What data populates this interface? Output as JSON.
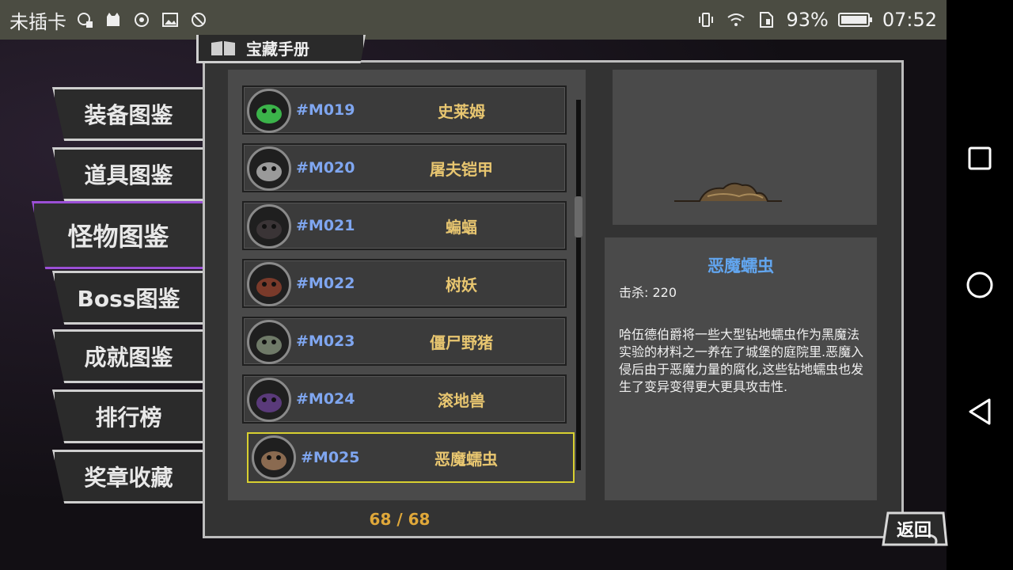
{
  "status_bar": {
    "carrier": "未插卡",
    "battery": "93%",
    "time": "07:52",
    "icons": [
      "sim-bubble-icon",
      "cat-app-icon",
      "camera-ring-icon",
      "image-icon",
      "no-circle-icon",
      "vibrate-icon",
      "wifi-icon",
      "sim-card-icon",
      "battery-icon"
    ]
  },
  "navbar": {
    "icons": [
      "recent-apps-icon",
      "home-icon",
      "back-triangle-icon"
    ]
  },
  "title": "宝藏手册",
  "tabs": [
    {
      "label": "装备图鉴",
      "active": false
    },
    {
      "label": "道具图鉴",
      "active": false
    },
    {
      "label": "怪物图鉴",
      "active": true
    },
    {
      "label": "Boss图鉴",
      "active": false
    },
    {
      "label": "成就图鉴",
      "active": false
    },
    {
      "label": "排行榜",
      "active": false
    },
    {
      "label": "奖章收藏",
      "active": false
    }
  ],
  "monsters": [
    {
      "id": "#M019",
      "name": "史莱姆",
      "icon": "slime-icon",
      "color": "#3bb34a"
    },
    {
      "id": "#M020",
      "name": "屠夫铠甲",
      "icon": "armor-icon",
      "color": "#9a9a9a"
    },
    {
      "id": "#M021",
      "name": "蝙蝠",
      "icon": "bat-icon",
      "color": "#3a3436"
    },
    {
      "id": "#M022",
      "name": "树妖",
      "icon": "treant-icon",
      "color": "#7a3a2a"
    },
    {
      "id": "#M023",
      "name": "僵尸野猪",
      "icon": "zombie-boar-icon",
      "color": "#6f7a68"
    },
    {
      "id": "#M024",
      "name": "滚地兽",
      "icon": "roller-beast-icon",
      "color": "#5a3a7a"
    },
    {
      "id": "#M025",
      "name": "恶魔蠕虫",
      "icon": "worm-icon",
      "color": "#8a6a50",
      "selected": true
    }
  ],
  "pager": "68 / 68",
  "detail": {
    "name": "恶魔蠕虫",
    "kills": "击杀: 220",
    "description": "哈伍德伯爵将一些大型钻地蠕虫作为黑魔法实验的材料之一养在了城堡的庭院里.恶魔入侵后由于恶魔力量的腐化,这些钻地蠕虫也发生了变异变得更大更具攻击性."
  },
  "back_label": "返回"
}
